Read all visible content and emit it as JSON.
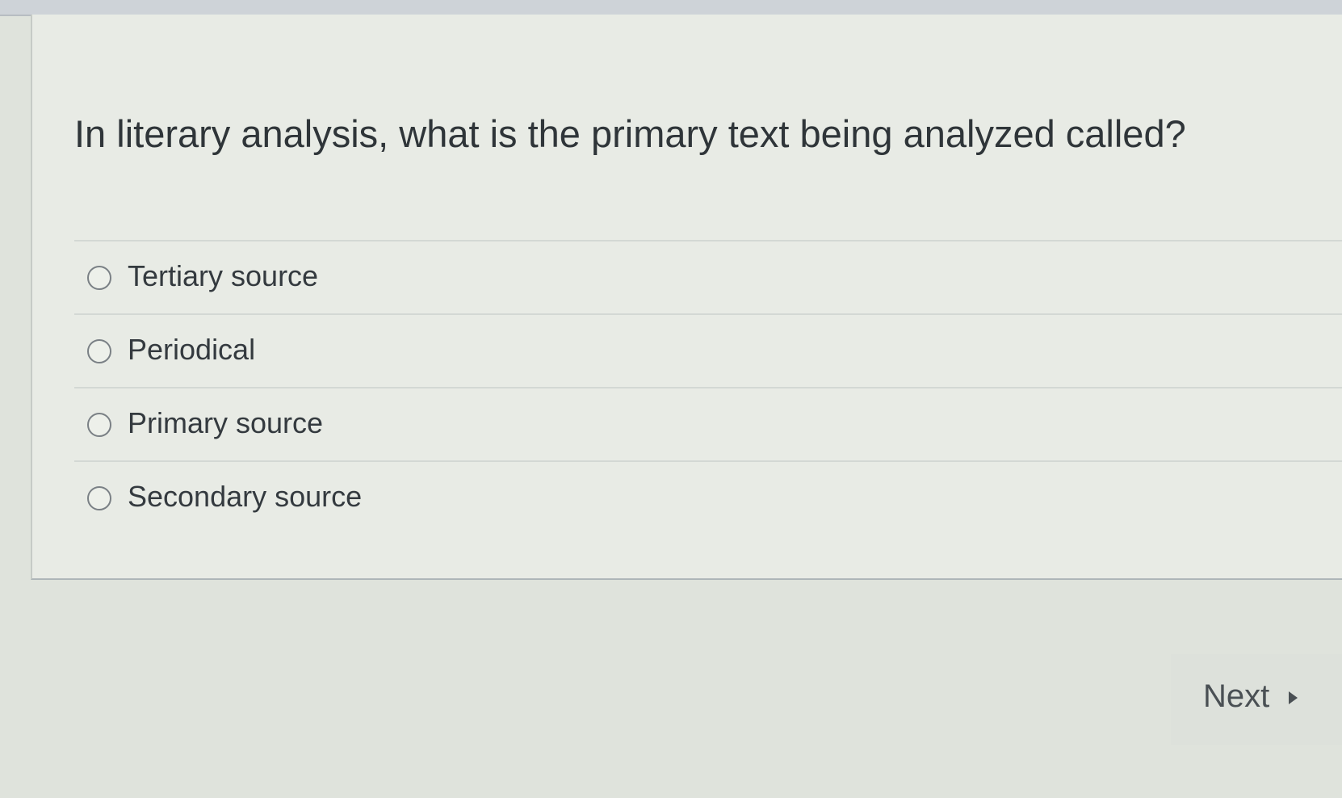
{
  "question": {
    "text": "In literary analysis, what is the primary text being analyzed called?"
  },
  "answers": [
    {
      "label": "Tertiary source",
      "selected": false
    },
    {
      "label": "Periodical",
      "selected": false
    },
    {
      "label": "Primary source",
      "selected": false
    },
    {
      "label": "Secondary source",
      "selected": false
    }
  ],
  "navigation": {
    "next_label": "Next",
    "next_icon": "triangle-right-icon"
  },
  "colors": {
    "background": "#dfe3dc",
    "card": "#e8ebe5",
    "text": "#2f3539"
  }
}
